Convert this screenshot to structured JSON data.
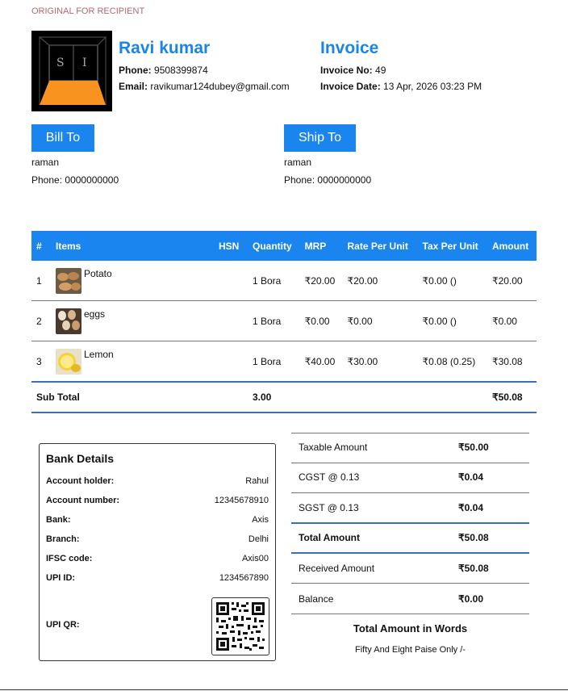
{
  "header": {
    "recipient_label": "ORIGINAL FOR RECIPIENT",
    "seller_name": "Ravi kumar",
    "phone_label": "Phone:",
    "phone": "9508399874",
    "email_label": "Email:",
    "email": "ravikumar124dubey@gmail.com",
    "invoice_title": "Invoice",
    "invoice_no_label": "Invoice No:",
    "invoice_no": "49",
    "invoice_date_label": "Invoice Date:",
    "invoice_date": "13 Apr, 2026 03:23 PM",
    "logo_letters": [
      "S",
      "I"
    ]
  },
  "bill_to": {
    "label": "Bill To",
    "name": "raman",
    "phone_label": "Phone:",
    "phone": "0000000000"
  },
  "ship_to": {
    "label": "Ship To",
    "name": "raman",
    "phone_label": "Phone:",
    "phone": "0000000000"
  },
  "table": {
    "headers": [
      "#",
      "Items",
      "HSN",
      "Quantity",
      "MRP",
      "Rate Per Unit",
      "Tax Per Unit",
      "Amount"
    ],
    "rows": [
      {
        "n": "1",
        "item": "Potato",
        "hsn": "",
        "qty": "1 Bora",
        "mrp": "₹20.00",
        "rate": "₹20.00",
        "tax": "₹0.00 ()",
        "amount": "₹20.00",
        "thumb": "potato-thumbnail"
      },
      {
        "n": "2",
        "item": "eggs",
        "hsn": "",
        "qty": "1 Bora",
        "mrp": "₹0.00",
        "rate": "₹0.00",
        "tax": "₹0.00 ()",
        "amount": "₹0.00",
        "thumb": "eggs-thumbnail"
      },
      {
        "n": "3",
        "item": "Lemon",
        "hsn": "",
        "qty": "1 Bora",
        "mrp": "₹40.00",
        "rate": "₹30.00",
        "tax": "₹0.08 (0.25)",
        "amount": "₹30.08",
        "thumb": "lemon-thumbnail"
      }
    ],
    "subtotal": {
      "label": "Sub Total",
      "qty": "3.00",
      "amount": "₹50.08"
    }
  },
  "bank": {
    "title": "Bank Details",
    "rows": [
      {
        "k": "Account holder:",
        "v": "Rahul"
      },
      {
        "k": "Account number:",
        "v": "12345678910"
      },
      {
        "k": "Bank:",
        "v": "Axis"
      },
      {
        "k": "Branch:",
        "v": "Delhi"
      },
      {
        "k": "IFSC code:",
        "v": "Axis00"
      },
      {
        "k": "UPI ID:",
        "v": "1234567890"
      }
    ],
    "upi_qr_label": "UPI QR:"
  },
  "summary": [
    {
      "k": "Taxable Amount",
      "v": "₹50.00"
    },
    {
      "k": "CGST @ 0.13",
      "v": "₹0.04"
    },
    {
      "k": "SGST @ 0.13",
      "v": "₹0.04"
    },
    {
      "k": "Total Amount",
      "v": "₹50.08"
    },
    {
      "k": "Received Amount",
      "v": "₹50.08"
    },
    {
      "k": "Balance",
      "v": "₹0.00"
    }
  ],
  "words": {
    "title": "Total Amount in Words",
    "text": "Fifty And Eight Paise Only /-"
  },
  "colors": {
    "accent": "#1a85ee",
    "title_blue": "#1a85e8",
    "logo_orange": "#f7931e",
    "divider_blue": "#3a6fb0"
  }
}
